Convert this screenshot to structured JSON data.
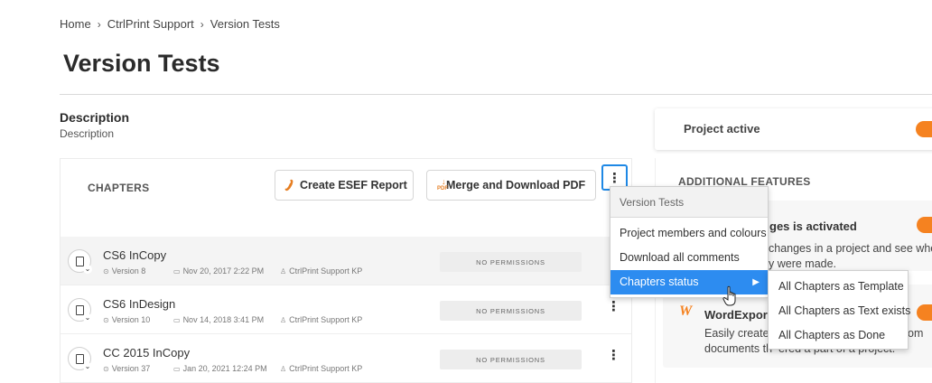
{
  "breadcrumb": {
    "items": [
      "Home",
      "CtrlPrint Support",
      "Version Tests"
    ],
    "separator": "›"
  },
  "page_title": "Version Tests",
  "description": {
    "heading": "Description",
    "text": "Description"
  },
  "chapters": {
    "label": "CHAPTERS",
    "create_esef_label": "Create ESEF Report",
    "merge_pdf_label": "Merge and Download PDF",
    "pdf_icon_text": "PDF",
    "more_icon": "⋮",
    "rows": [
      {
        "title": "CS6 InCopy",
        "version": "Version 8",
        "date": "Nov 20, 2017 2:22 PM",
        "owner": "CtrlPrint Support KP",
        "permission": "NO PERMISSIONS"
      },
      {
        "title": "CS6 InDesign",
        "version": "Version 10",
        "date": "Nov 14, 2018 3:41 PM",
        "owner": "CtrlPrint Support KP",
        "permission": "NO PERMISSIONS"
      },
      {
        "title": "CC 2015 InCopy",
        "version": "Version 37",
        "date": "Jan 20, 2021 12:24 PM",
        "owner": "CtrlPrint Support KP",
        "permission": "NO PERMISSIONS"
      }
    ]
  },
  "right_panel": {
    "project_active_label": "Project active",
    "additional_features_label": "ADDITIONAL FEATURES",
    "feature1": {
      "title": "ges is activated",
      "line1": "changes in a project and see when",
      "line2": "y were made."
    },
    "feature2": {
      "icon_letter": "W",
      "title": "WordExpor",
      "line1_a": "Easily create a",
      "line1_b": "om",
      "line2": "documents th",
      "line2_b": "ered a part of a project."
    }
  },
  "dropdown": {
    "header": "Version Tests",
    "items": [
      "Project members and colours",
      "Download all comments",
      "Chapters status"
    ],
    "submenu_arrow": "▶",
    "submenu": [
      "All Chapters as Template",
      "All Chapters as Text exists",
      "All Chapters as Done"
    ]
  },
  "colors": {
    "accent_orange": "#f58220",
    "menu_highlight": "#2d8cf0",
    "focus_blue": "#1e88e5"
  }
}
